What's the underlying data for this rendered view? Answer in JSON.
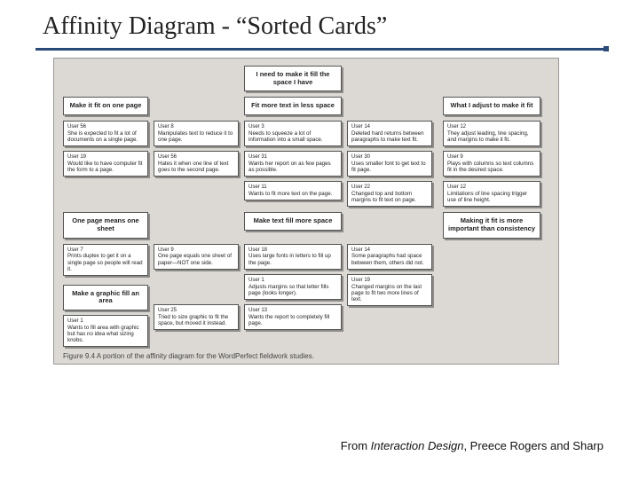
{
  "title": "Affinity Diagram - “Sorted Cards”",
  "credit": {
    "prefix": "From ",
    "book": "Interaction Design",
    "suffix": ", Preece Rogers and Sharp"
  },
  "caption": "Figure 9.4  A portion of the affinity diagram for the WordPerfect fieldwork studies.",
  "top": {
    "h1": "I need to make it fill the space I have",
    "h2a": "Make it fit on one page",
    "h2b": "Fit more text in less space",
    "h2c": "What I adjust to make it fit"
  },
  "b1": {
    "c1a_u": "User 56",
    "c1a_t": "She is expected to fit a lot of documents on a single page.",
    "c1b_u": "User 19",
    "c1b_t": "Would like to have computer fit the form to a page.",
    "c2a_u": "User 8",
    "c2a_t": "Manipulates text to reduce it to one page.",
    "c2b_u": "User 56",
    "c2b_t": "Hates it when one line of text goes to the second page.",
    "c3a_u": "User 3",
    "c3a_t": "Needs to squeeze a lot of information into a small space.",
    "c3b_u": "User 31",
    "c3b_t": "Wants her report on as few pages as possible.",
    "c3c_u": "User 11",
    "c3c_t": "Wants to fit more text on the page.",
    "c4a_u": "User 14",
    "c4a_t": "Deleted hard returns between paragraphs to make text fit.",
    "c4b_u": "User 30",
    "c4b_t": "Uses smaller font to get text to fit page.",
    "c4c_u": "User 22",
    "c4c_t": "Changed top and bottom margins to fit text on page.",
    "c5a_u": "User 12",
    "c5a_t": "They adjust leading, line spacing, and margins to make it fit.",
    "c5b_u": "User 9",
    "c5b_t": "Plays with columns so text columns fit in the desired space.",
    "c5c_u": "User 12",
    "c5c_t": "Limitations of line spacing trigger use of line height."
  },
  "mid": {
    "h2d": "One page means one sheet",
    "h2e": "Make text fill more space",
    "h2f": "Making it fit is more important than consistency"
  },
  "b2": {
    "c1a_u": "User 7",
    "c1a_t": "Prints duplex to get it on a single page so people will read it.",
    "c2a_u": "User 9",
    "c2a_t": "One page equals one sheet of paper—NOT one side.",
    "c3a_u": "User 18",
    "c3a_t": "Uses large fonts in letters to fill up the page.",
    "c3b_u": "User 1",
    "c3b_t": "Adjusts margins so that letter fills page (looks longer).",
    "c3c_u": "User 13",
    "c3c_t": "Wants the report to completely fill page.",
    "c4a_u": "User 14",
    "c4a_t": "Some paragraphs had space between them, others did not.",
    "c4b_u": "User 19",
    "c4b_t": "Changed margins on the last page to fit two more lines of text."
  },
  "bot": {
    "h2g": "Make a graphic fill an area",
    "c1a_u": "User 1",
    "c1a_t": "Wants to fill area with graphic but has no idea what sizing knobs.",
    "c2a_u": "User 25",
    "c2a_t": "Tried to size graphic to fit the space, but moved it instead."
  }
}
